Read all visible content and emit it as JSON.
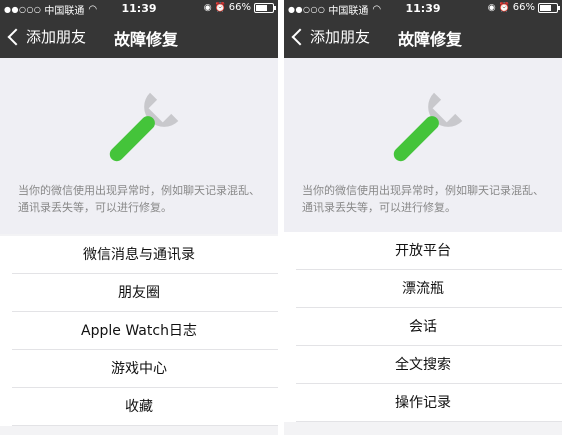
{
  "status_bar": {
    "carrier": "中国联通",
    "time": "11:39",
    "battery": "66%",
    "battery_level": 0.66
  },
  "nav": {
    "back_label": "添加朋友",
    "title": "故障修复"
  },
  "description": "当你的微信使用出现异常时，例如聊天记录混乱、通讯录丢失等，可以进行修复。",
  "left_screen": {
    "items": [
      "微信消息与通讯录",
      "朋友圈",
      "Apple Watch日志",
      "游戏中心",
      "收藏"
    ]
  },
  "right_screen": {
    "items": [
      "开放平台",
      "漂流瓶",
      "会话",
      "全文搜索",
      "操作记录"
    ]
  },
  "colors": {
    "nav_background": "#363636",
    "wrench_handle": "#44c43a",
    "wrench_head": "#c8c8cc"
  },
  "icons": [
    "wrench-icon",
    "chevron-left-icon",
    "wifi-icon",
    "lock-icon",
    "alarm-icon",
    "battery-icon"
  ]
}
